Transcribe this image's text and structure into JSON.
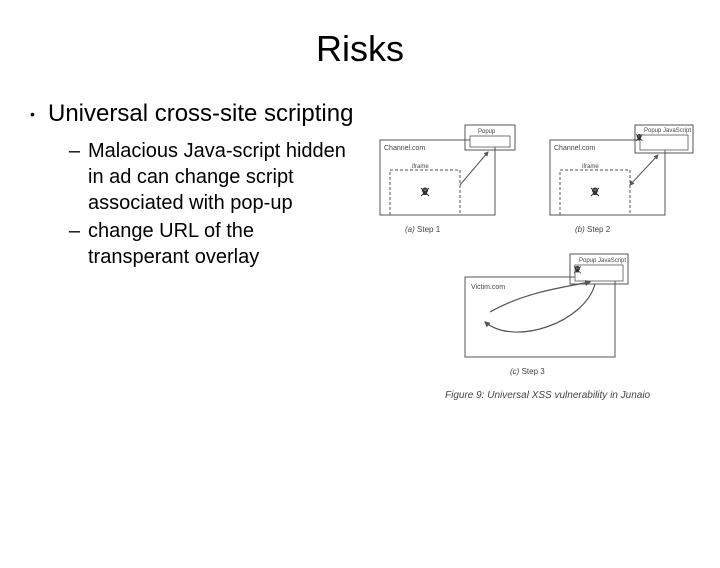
{
  "title": "Risks",
  "bullet": "Universal cross-site scripting",
  "subs": [
    "Malacious Java-script hidden in ad can change script associated with pop-up",
    "change URL of the transperant overlay"
  ],
  "fig": {
    "step1": "Step 1",
    "step2": "Step 2",
    "step3": "Step 3",
    "a": "(a)",
    "b": "(b)",
    "c": "(c)",
    "channel": "Channel.com",
    "victim": "Victim.com",
    "iframe": "iframe",
    "popup": "Popup",
    "popup_js": "Popup JavaScript",
    "caption": "Figure 9: Universal XSS vulnerability in Junaio"
  }
}
